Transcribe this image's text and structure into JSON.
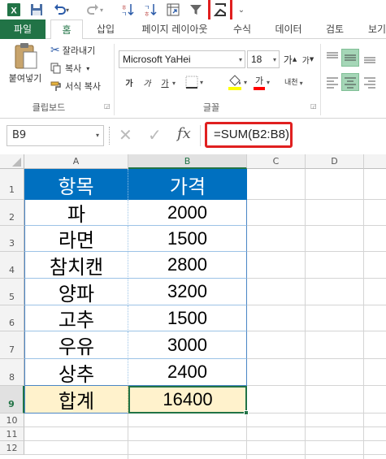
{
  "qat": {
    "undo_arrow": "▾",
    "redo_arrow": "▾",
    "more": "⌄"
  },
  "tabs": [
    "파일",
    "홈",
    "삽입",
    "페이지 레이아웃",
    "수식",
    "데이터",
    "검토",
    "보기"
  ],
  "clipboard": {
    "paste_label": "붙여넣기",
    "cut_label": "잘라내기",
    "copy_label": "복사",
    "copy_arrow": "▾",
    "format_painter_label": "서식 복사",
    "group_label": "클립보드"
  },
  "font": {
    "name": "Microsoft YaHei",
    "size": "18",
    "grow": "가",
    "shrink": "가",
    "bold": "가",
    "italic": "가",
    "underline": "가",
    "phonetic": "내천",
    "group_label": "글꼴"
  },
  "formula_bar": {
    "name_box": "B9",
    "cancel": "✕",
    "enter": "✓",
    "fx": "fx",
    "formula": "=SUM(B2:B8)"
  },
  "grid": {
    "columns": [
      "A",
      "B",
      "C",
      "D"
    ],
    "rows": [
      "1",
      "2",
      "3",
      "4",
      "5",
      "6",
      "7",
      "8",
      "9",
      "10",
      "11",
      "12"
    ],
    "header": {
      "item": "항목",
      "price": "가격"
    },
    "items": [
      {
        "item": "파",
        "price": "2000"
      },
      {
        "item": "라면",
        "price": "1500"
      },
      {
        "item": "참치캔",
        "price": "2800"
      },
      {
        "item": "양파",
        "price": "3200"
      },
      {
        "item": "고추",
        "price": "1500"
      },
      {
        "item": "우유",
        "price": "3000"
      },
      {
        "item": "상추",
        "price": "2400"
      }
    ],
    "total": {
      "item": "합계",
      "price": "16400"
    }
  },
  "colors": {
    "excel_green": "#217346",
    "header_blue": "#0070c0",
    "total_fill": "#fff2cc",
    "highlight_red": "#e02020"
  }
}
